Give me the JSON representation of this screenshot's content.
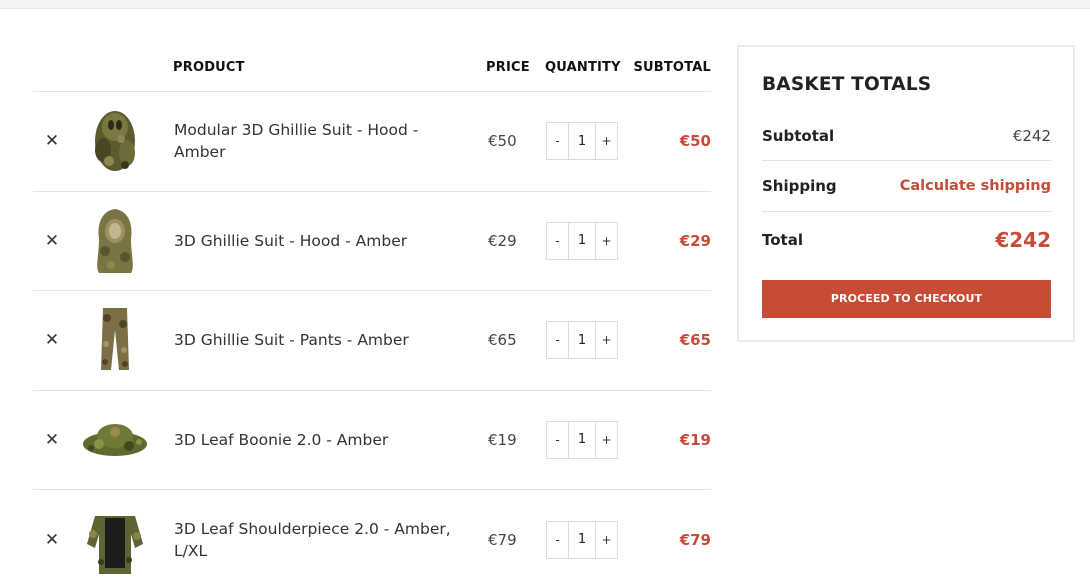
{
  "cart": {
    "headers": {
      "product": "PRODUCT",
      "price": "PRICE",
      "quantity": "QUANTITY",
      "subtotal": "SUBTOTAL"
    },
    "remove_icon": "close-icon",
    "decrement_label": "-",
    "increment_label": "+",
    "items": [
      {
        "name": "Modular 3D Ghillie Suit - Hood - Amber",
        "price": "€50",
        "quantity": "1",
        "subtotal": "€50"
      },
      {
        "name": "3D Ghillie Suit - Hood - Amber",
        "price": "€29",
        "quantity": "1",
        "subtotal": "€29"
      },
      {
        "name": "3D Ghillie Suit - Pants - Amber",
        "price": "€65",
        "quantity": "1",
        "subtotal": "€65"
      },
      {
        "name": "3D Leaf Boonie 2.0 - Amber",
        "price": "€19",
        "quantity": "1",
        "subtotal": "€19"
      },
      {
        "name": "3D Leaf Shoulderpiece 2.0 - Amber, L/XL",
        "price": "€79",
        "quantity": "1",
        "subtotal": "€79"
      }
    ]
  },
  "totals": {
    "title": "BASKET TOTALS",
    "subtotal_label": "Subtotal",
    "subtotal_value": "€242",
    "shipping_label": "Shipping",
    "shipping_link": "Calculate shipping",
    "total_label": "Total",
    "total_value": "€242",
    "checkout_label": "PROCEED TO CHECKOUT"
  },
  "colors": {
    "accent": "#c84b35",
    "camo_dark": "#3f3a22",
    "camo_mid": "#6b6a35",
    "camo_light": "#8f8a4e"
  }
}
